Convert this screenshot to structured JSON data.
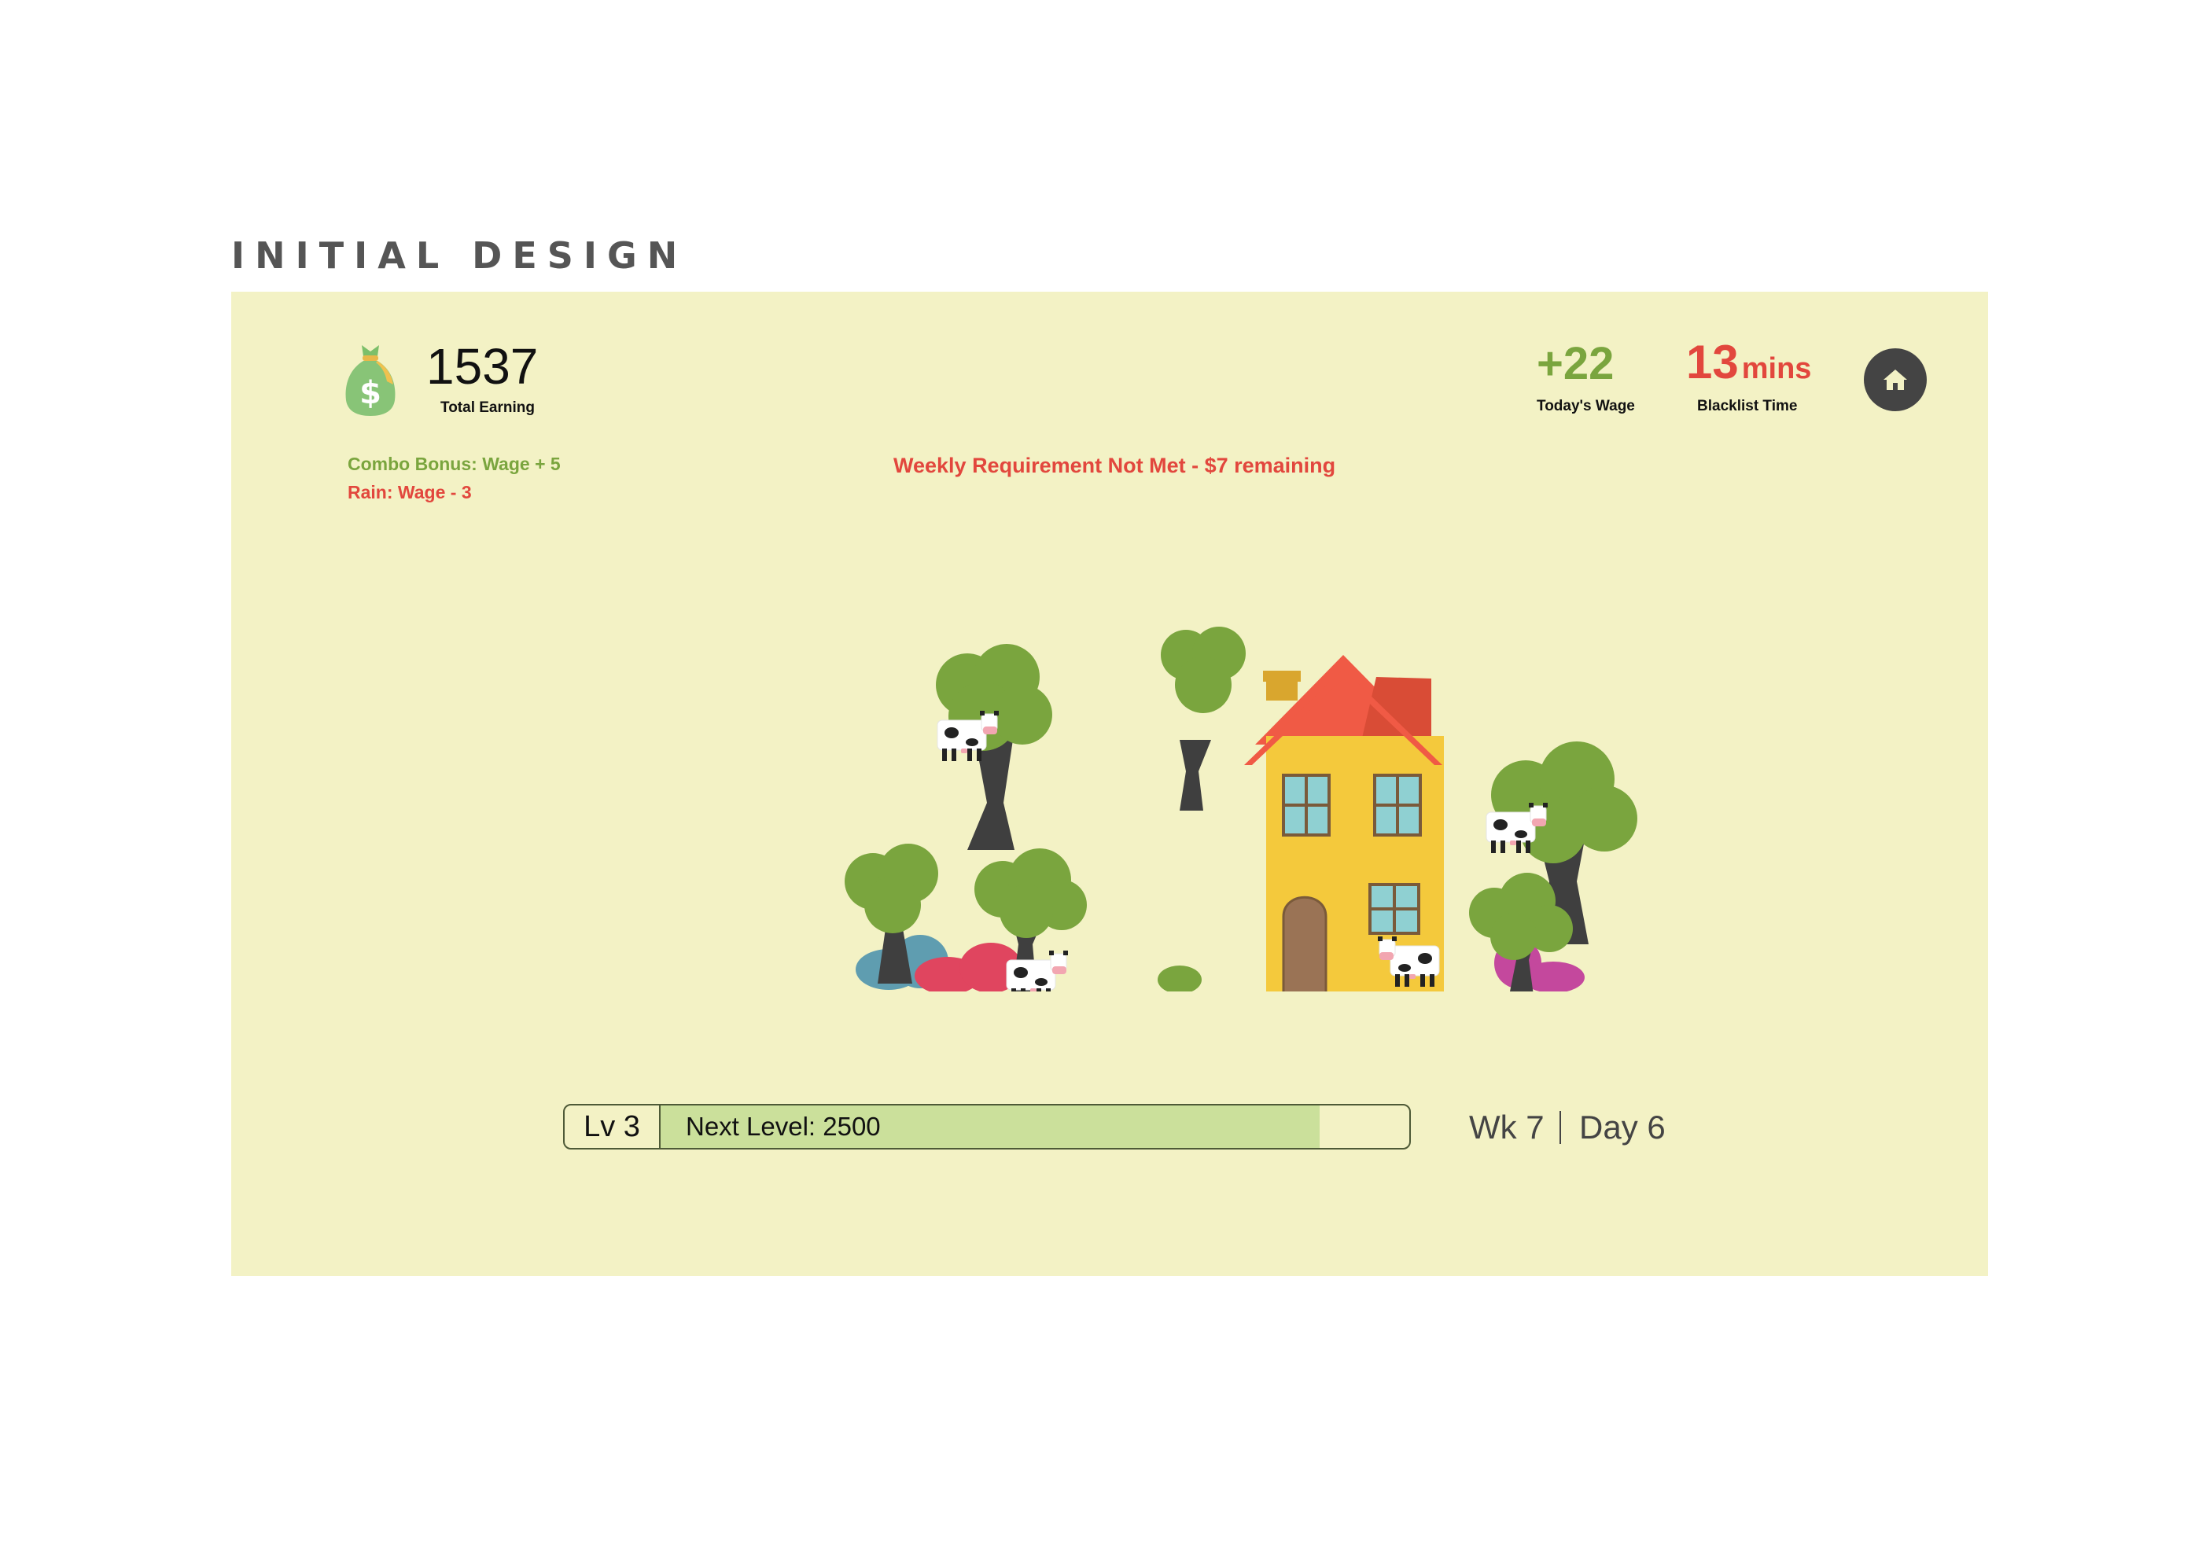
{
  "heading": "INITIAL DESIGN",
  "stats": {
    "total_earning": "1537",
    "total_earning_label": "Total Earning",
    "todays_wage": "+22",
    "todays_wage_label": "Today's Wage",
    "blacklist_value": "13",
    "blacklist_unit": "mins",
    "blacklist_label": "Blacklist Time"
  },
  "modifiers": {
    "combo": "Combo Bonus: Wage + 5",
    "rain": "Rain: Wage - 3"
  },
  "warning": "Weekly Requirement Not Met - $7 remaining",
  "progress": {
    "level_label": "Lv 3",
    "next_label": "Next Level: 2500",
    "fill_fraction": 0.88
  },
  "calendar": {
    "week": "Wk 7",
    "day": "Day 6"
  },
  "icons": {
    "money": "money-bag-icon",
    "home": "home-icon"
  },
  "colors": {
    "background": "#f3f2c5",
    "positive": "#7aa53e",
    "negative": "#e2473d",
    "progress_fill": "#cbe09b",
    "home_button": "#444444"
  }
}
